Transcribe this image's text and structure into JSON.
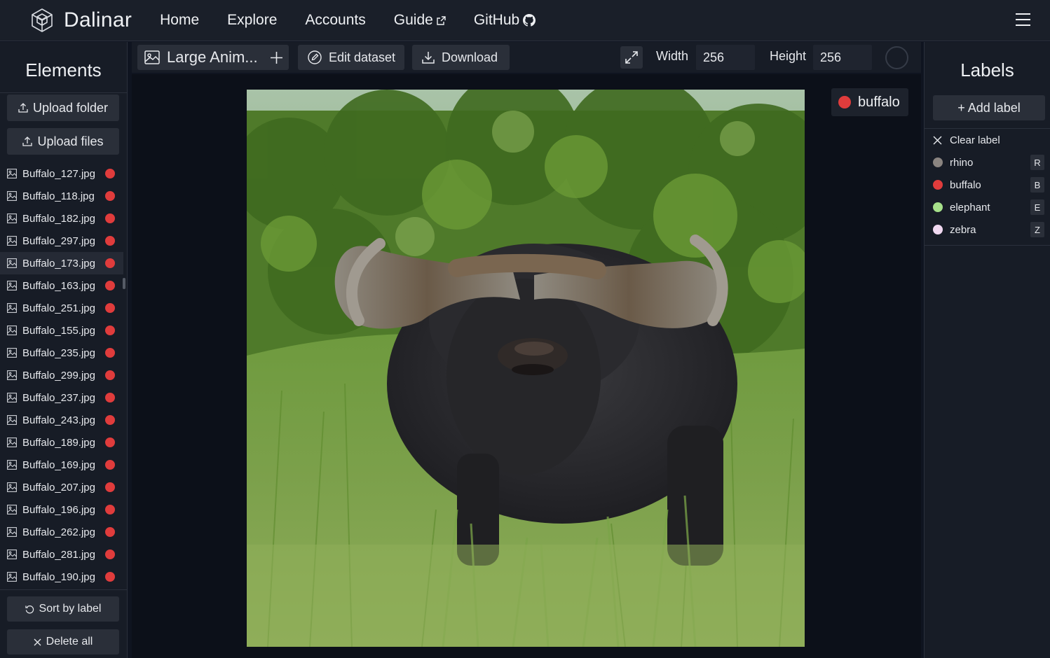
{
  "app": {
    "brand": "Dalinar",
    "nav": [
      {
        "label": "Home",
        "icon": null
      },
      {
        "label": "Explore",
        "icon": null
      },
      {
        "label": "Accounts",
        "icon": null
      },
      {
        "label": "Guide",
        "icon": "external-link-icon"
      },
      {
        "label": "GitHub",
        "icon": "github-icon"
      }
    ]
  },
  "left_panel": {
    "title": "Elements",
    "upload_folder": "Upload folder",
    "upload_files": "Upload files",
    "files": [
      {
        "name": "Buffalo_127.jpg",
        "label_color": "#e03c3c",
        "selected": false
      },
      {
        "name": "Buffalo_118.jpg",
        "label_color": "#e03c3c",
        "selected": false
      },
      {
        "name": "Buffalo_182.jpg",
        "label_color": "#e03c3c",
        "selected": false
      },
      {
        "name": "Buffalo_297.jpg",
        "label_color": "#e03c3c",
        "selected": false
      },
      {
        "name": "Buffalo_173.jpg",
        "label_color": "#e03c3c",
        "selected": true
      },
      {
        "name": "Buffalo_163.jpg",
        "label_color": "#e03c3c",
        "selected": false
      },
      {
        "name": "Buffalo_251.jpg",
        "label_color": "#e03c3c",
        "selected": false
      },
      {
        "name": "Buffalo_155.jpg",
        "label_color": "#e03c3c",
        "selected": false
      },
      {
        "name": "Buffalo_235.jpg",
        "label_color": "#e03c3c",
        "selected": false
      },
      {
        "name": "Buffalo_299.jpg",
        "label_color": "#e03c3c",
        "selected": false
      },
      {
        "name": "Buffalo_237.jpg",
        "label_color": "#e03c3c",
        "selected": false
      },
      {
        "name": "Buffalo_243.jpg",
        "label_color": "#e03c3c",
        "selected": false
      },
      {
        "name": "Buffalo_189.jpg",
        "label_color": "#e03c3c",
        "selected": false
      },
      {
        "name": "Buffalo_169.jpg",
        "label_color": "#e03c3c",
        "selected": false
      },
      {
        "name": "Buffalo_207.jpg",
        "label_color": "#e03c3c",
        "selected": false
      },
      {
        "name": "Buffalo_196.jpg",
        "label_color": "#e03c3c",
        "selected": false
      },
      {
        "name": "Buffalo_262.jpg",
        "label_color": "#e03c3c",
        "selected": false
      },
      {
        "name": "Buffalo_281.jpg",
        "label_color": "#e03c3c",
        "selected": false
      },
      {
        "name": "Buffalo_190.jpg",
        "label_color": "#e03c3c",
        "selected": false
      }
    ],
    "sort_by_label": "Sort by label",
    "delete_all": "Delete all"
  },
  "toolbar": {
    "dataset_name": "Large Anim...",
    "edit_dataset": "Edit dataset",
    "download": "Download",
    "width_label": "Width",
    "width_value": "256",
    "height_label": "Height",
    "height_value": "256"
  },
  "canvas": {
    "current_label": "buffalo",
    "current_label_color": "#e03c3c"
  },
  "right_panel": {
    "title": "Labels",
    "add_label": "+ Add label",
    "clear_label": "Clear label",
    "labels": [
      {
        "name": "rhino",
        "color": "#8a8480",
        "hotkey": "R"
      },
      {
        "name": "buffalo",
        "color": "#e03c3c",
        "hotkey": "B"
      },
      {
        "name": "elephant",
        "color": "#a6e08a",
        "hotkey": "E"
      },
      {
        "name": "zebra",
        "color": "#f0d8f0",
        "hotkey": "Z"
      }
    ]
  }
}
